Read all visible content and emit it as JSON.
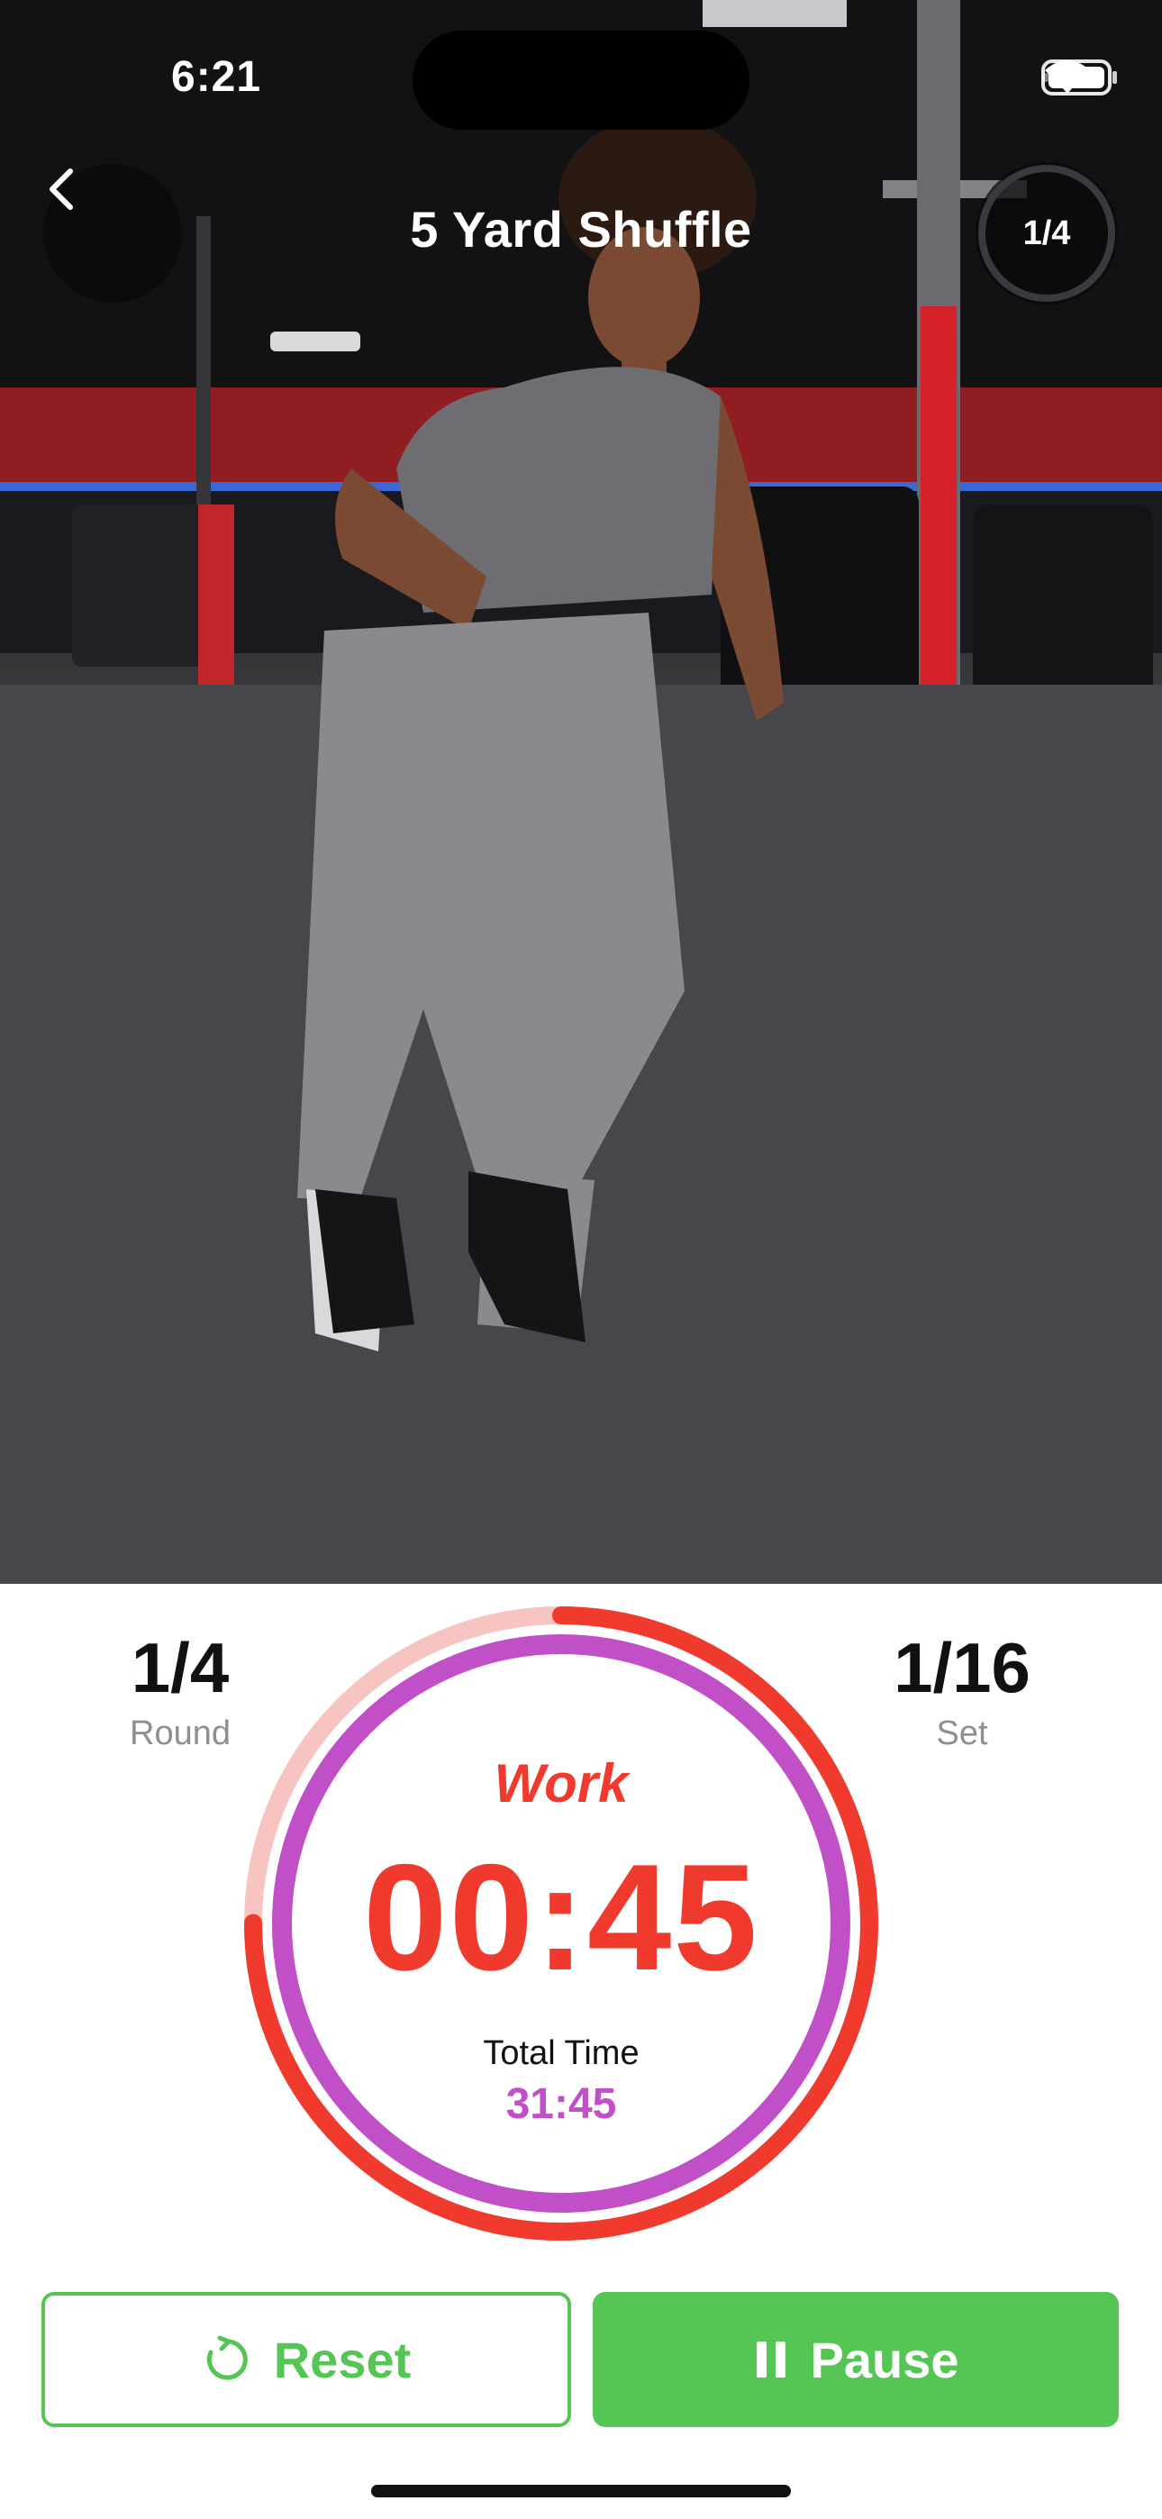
{
  "status_bar": {
    "time": "6:21"
  },
  "header": {
    "title": "5 Yard Shuffle",
    "progress_text": "1/4",
    "progress_fraction": 0.25
  },
  "stats": {
    "round": {
      "value": "1/4",
      "label": "Round"
    },
    "set": {
      "value": "1/16",
      "label": "Set"
    }
  },
  "timer": {
    "phase": "Work",
    "time": "00:45",
    "total_label": "Total Time",
    "total_time": "31:45"
  },
  "buttons": {
    "reset": "Reset",
    "pause": "Pause"
  },
  "colors": {
    "accent_red": "#f03a2e",
    "accent_purple": "#c150c8",
    "button_green": "#55c553"
  }
}
